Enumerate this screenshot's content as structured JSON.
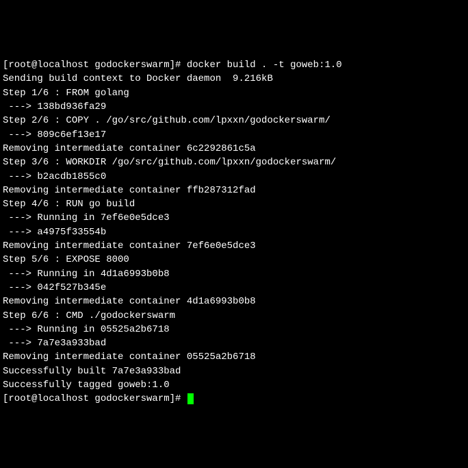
{
  "prompt1": {
    "prefix": "[root@localhost godockerswarm]# ",
    "command": "docker build . -t goweb:1.0"
  },
  "lines": [
    "Sending build context to Docker daemon  9.216kB",
    "Step 1/6 : FROM golang",
    " ---> 138bd936fa29",
    "Step 2/6 : COPY . /go/src/github.com/lpxxn/godockerswarm/",
    " ---> 809c6ef13e17",
    "Removing intermediate container 6c2292861c5a",
    "Step 3/6 : WORKDIR /go/src/github.com/lpxxn/godockerswarm/",
    " ---> b2acdb1855c0",
    "Removing intermediate container ffb287312fad",
    "Step 4/6 : RUN go build",
    " ---> Running in 7ef6e0e5dce3",
    " ---> a4975f33554b",
    "Removing intermediate container 7ef6e0e5dce3",
    "Step 5/6 : EXPOSE 8000",
    " ---> Running in 4d1a6993b0b8",
    " ---> 042f527b345e",
    "Removing intermediate container 4d1a6993b0b8",
    "Step 6/6 : CMD ./godockerswarm",
    " ---> Running in 05525a2b6718",
    " ---> 7a7e3a933bad",
    "Removing intermediate container 05525a2b6718",
    "Successfully built 7a7e3a933bad",
    "Successfully tagged goweb:1.0"
  ],
  "prompt2": {
    "prefix": "[root@localhost godockerswarm]# "
  }
}
